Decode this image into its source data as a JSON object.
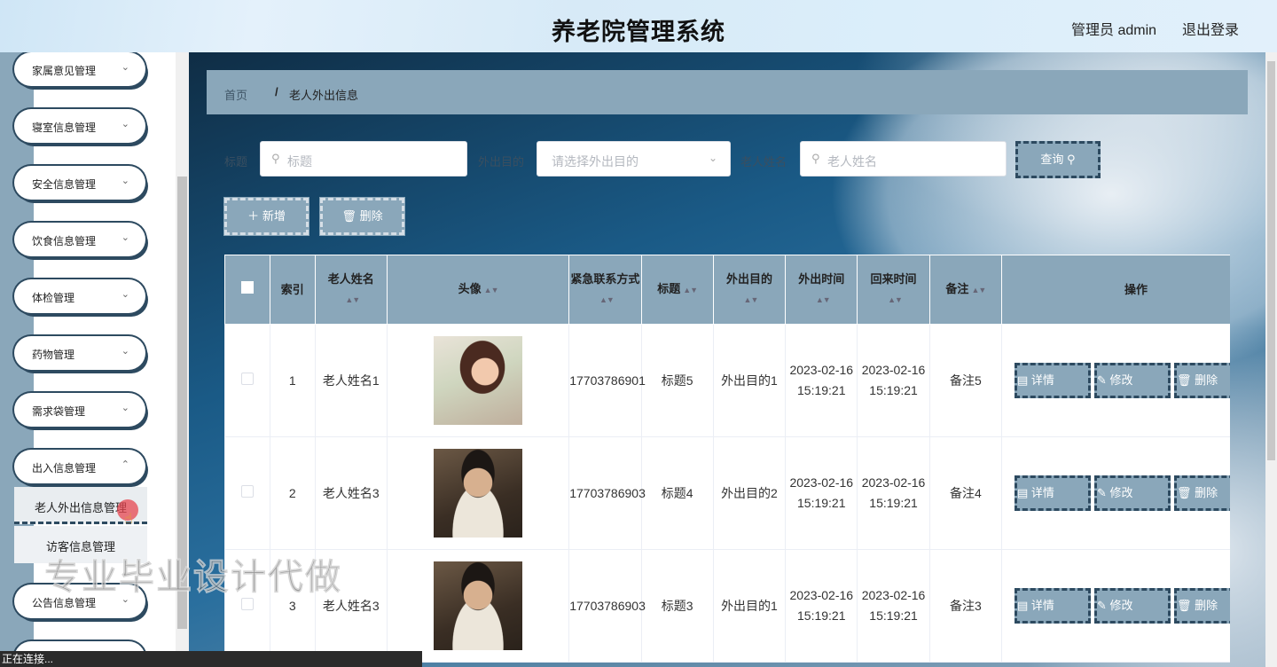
{
  "header": {
    "title": "养老院管理系统",
    "user": "管理员 admin",
    "logout": "退出登录"
  },
  "sidebar": {
    "items": [
      {
        "label": "家属意见管理"
      },
      {
        "label": "寝室信息管理"
      },
      {
        "label": "安全信息管理"
      },
      {
        "label": "饮食信息管理"
      },
      {
        "label": "体检管理"
      },
      {
        "label": "药物管理"
      },
      {
        "label": "需求袋管理"
      },
      {
        "label": "出入信息管理"
      },
      {
        "label": "公告信息管理"
      }
    ],
    "sub_items": [
      {
        "label": "老人外出信息管理",
        "active": true
      },
      {
        "label": "访客信息管理",
        "active": false
      }
    ]
  },
  "breadcrumb": {
    "home": "首页",
    "sep": "/",
    "current": "老人外出信息"
  },
  "search": {
    "title_label": "标题",
    "title_placeholder": "标题",
    "purpose_label": "外出目的",
    "purpose_placeholder": "请选择外出目的",
    "name_label": "老人姓名",
    "name_placeholder": "老人姓名",
    "query_button": "查询"
  },
  "actions": {
    "add": "新增",
    "delete": "删除"
  },
  "table": {
    "headers": {
      "index": "索引",
      "name": "老人姓名",
      "avatar": "头像",
      "phone": "紧急联系方式",
      "title": "标题",
      "purpose": "外出目的",
      "out_time": "外出时间",
      "return_time": "回来时间",
      "note": "备注",
      "ops": "操作"
    },
    "rows": [
      {
        "index": "1",
        "name": "老人姓名1",
        "phone": "17703786901",
        "title": "标题5",
        "purpose": "外出目的1",
        "out_time": "2023-02-16 15:19:21",
        "return_time": "2023-02-16 15:19:21",
        "note": "备注5"
      },
      {
        "index": "2",
        "name": "老人姓名3",
        "phone": "17703786903",
        "title": "标题4",
        "purpose": "外出目的2",
        "out_time": "2023-02-16 15:19:21",
        "return_time": "2023-02-16 15:19:21",
        "note": "备注4"
      },
      {
        "index": "3",
        "name": "老人姓名3",
        "phone": "17703786903",
        "title": "标题3",
        "purpose": "外出目的1",
        "out_time": "2023-02-16 15:19:21",
        "return_time": "2023-02-16 15:19:21",
        "note": "备注3"
      }
    ],
    "op_labels": {
      "detail": "详情",
      "edit": "修改",
      "delete": "删除"
    }
  },
  "watermark": "专业毕业设计代做",
  "status": "正在连接..."
}
